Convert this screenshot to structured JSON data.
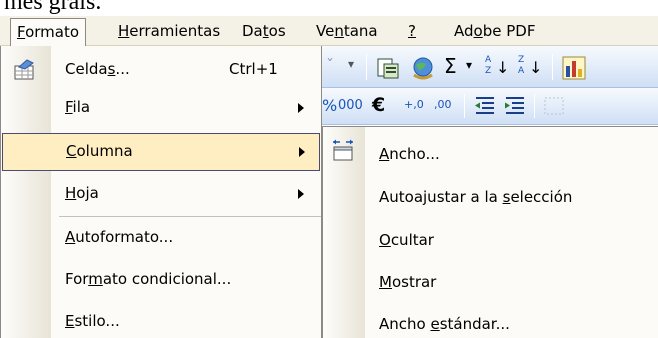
{
  "caption": "mes grals.",
  "menubar": {
    "items": [
      {
        "label": "Formato",
        "key": "F",
        "active": true
      },
      {
        "label": "Herramientas",
        "key": "H"
      },
      {
        "label": "Datos",
        "key": "t"
      },
      {
        "label": "Ventana",
        "key": "n"
      },
      {
        "label": "?",
        "key": "?"
      },
      {
        "label": "Adobe PDF",
        "key": "o"
      }
    ]
  },
  "toolbar": {
    "sigma": "Σ",
    "dropdown": "▾",
    "thousands": "000",
    "euro": "€",
    "inc_decimal": "+,0",
    "dec_decimal": ",00",
    "sort_asc_top": "A",
    "sort_asc_bottom": "Z",
    "sort_desc_top": "Z",
    "sort_desc_bottom": "A"
  },
  "format_menu": {
    "items": [
      {
        "label": "Celdas...",
        "underline_index": 5,
        "shortcut": "Ctrl+1",
        "submenu": false,
        "icon": "format-cells-icon"
      },
      {
        "label": "Fila",
        "underline_index": 0,
        "submenu": true
      },
      {
        "label": "Columna",
        "underline_index": 0,
        "submenu": true,
        "highlighted": true
      },
      {
        "label": "Hoja",
        "underline_index": 0,
        "submenu": true
      },
      {
        "label": "Autoformato...",
        "underline_index": 0,
        "submenu": false
      },
      {
        "label": "Formato condicional...",
        "underline_index": 3,
        "submenu": false
      },
      {
        "label": "Estilo...",
        "underline_index": 0,
        "submenu": false
      }
    ]
  },
  "column_submenu": {
    "items": [
      {
        "label": "Ancho...",
        "underline_index": 0,
        "icon": "column-width-icon"
      },
      {
        "label": "Autoajustar a la selección",
        "underline_index": 17
      },
      {
        "label": "Ocultar",
        "underline_index": 0
      },
      {
        "label": "Mostrar",
        "underline_index": 0
      },
      {
        "label": "Ancho estándar...",
        "underline_index": 6
      }
    ]
  },
  "colors": {
    "menu_bg": "#fcfbf7",
    "highlight_bg": "#ffeec2",
    "highlight_border": "#4b4b6f",
    "menubar_bg": "#f4f1e6",
    "toolbar_top": "#f7fafe",
    "toolbar_bottom": "#cfdff5"
  }
}
